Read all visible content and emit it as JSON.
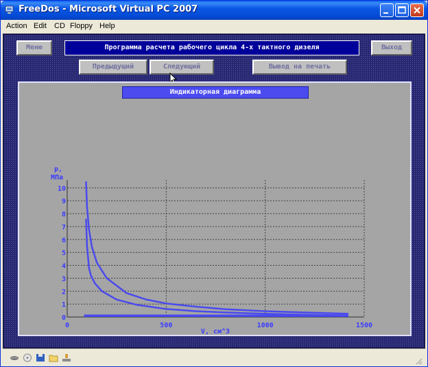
{
  "window": {
    "title": "FreeDos - Microsoft Virtual PC 2007"
  },
  "menubar": {
    "items": [
      "Action",
      "Edit",
      "CD",
      "Floppy",
      "Help"
    ]
  },
  "app": {
    "menu_button": "Меню",
    "program_title": "Программа расчета рабочего цикла 4-х тактного дизеля",
    "exit_button": "Выход",
    "prev_button": "Предыдущий",
    "next_button": "Следующий",
    "print_button": "Вывод на печать",
    "diagram_title": "Индикаторная диаграмма"
  },
  "colors": {
    "curve": "#4a4aee",
    "axis_text": "#3a3aff",
    "panel_bg": "#a5a5a5",
    "title_bg": "#00009a"
  },
  "chart_data": {
    "type": "line",
    "title": "Индикаторная диаграмма",
    "ylabel_line1": "p,",
    "ylabel_line2": "МПа",
    "xlabel": "V, см^3",
    "xlim": [
      0,
      1500
    ],
    "ylim": [
      0,
      10.6
    ],
    "x_ticks": [
      0,
      500,
      1000,
      1500
    ],
    "y_ticks": [
      0,
      1,
      2,
      3,
      4,
      5,
      6,
      7,
      8,
      9,
      10
    ],
    "grid": true,
    "series": [
      {
        "x": [
          95,
          100,
          110,
          125,
          150,
          200,
          300,
          400,
          500,
          650,
          800,
          1000,
          1200,
          1420
        ],
        "y": [
          10.5,
          8.5,
          6.8,
          5.4,
          4.2,
          3.0,
          1.85,
          1.35,
          1.05,
          0.8,
          0.6,
          0.45,
          0.35,
          0.25
        ]
      },
      {
        "x": [
          95,
          100,
          110,
          120,
          140,
          175,
          250,
          350,
          500,
          650,
          800,
          1000,
          1200,
          1420
        ],
        "y": [
          7.6,
          5.5,
          3.8,
          3.2,
          2.6,
          2.0,
          1.35,
          0.95,
          0.62,
          0.45,
          0.35,
          0.25,
          0.18,
          0.12
        ]
      },
      {
        "x": [
          85,
          1420
        ],
        "y": [
          0.1,
          0.1
        ]
      }
    ]
  }
}
